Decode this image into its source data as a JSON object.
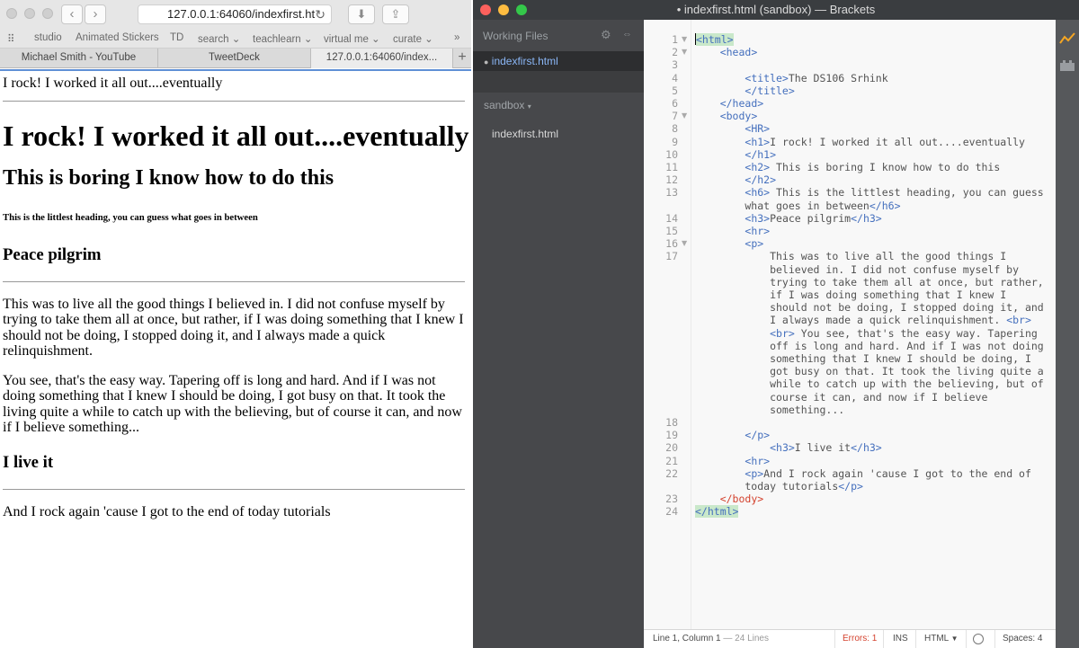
{
  "safari": {
    "url": "127.0.0.1:64060/indexfirst.ht",
    "bookmarks": [
      "studio",
      "Animated Stickers",
      "TD",
      "search",
      "teachlearn",
      "virtual me",
      "curate"
    ],
    "tabs": [
      "Michael Smith - YouTube",
      "TweetDeck",
      "127.0.0.1:64060/index..."
    ],
    "page": {
      "title_line": "I rock! I worked it all out....eventually",
      "h1": "I rock! I worked it all out....eventually",
      "h2": "This is boring I know how to do this",
      "h6": "This is the littlest heading, you can guess what goes in between",
      "h3_1": "Peace pilgrim",
      "p1": "This was to live all the good things I believed in. I did not confuse myself by trying to take them all at once, but rather, if I was doing something that I knew I should not be doing, I stopped doing it, and I always made a quick relinquishment.",
      "p2": "You see, that's the easy way. Tapering off is long and hard. And if I was not doing something that I knew I should be doing, I got busy on that. It took the living quite a while to catch up with the believing, but of course it can, and now if I believe something...",
      "h3_2": "I live it",
      "p3": "And I rock again 'cause I got to the end of today tutorials"
    }
  },
  "brackets": {
    "title": "• indexfirst.html (sandbox) — Brackets",
    "working_files_label": "Working Files",
    "working_file": "indexfirst.html",
    "project_label": "sandbox",
    "project_file": "indexfirst.html",
    "code_lines": [
      {
        "n": "1",
        "fold": "▼",
        "html": "<span id=\"cursor\"></span><span class=\"tg-g\">&lt;html&gt;</span>"
      },
      {
        "n": "2",
        "fold": "▼",
        "html": "    <span class=\"tg\">&lt;head&gt;</span>"
      },
      {
        "n": "3",
        "fold": "",
        "html": ""
      },
      {
        "n": "4",
        "fold": "",
        "html": "        <span class=\"tg\">&lt;title&gt;</span>The DS106 Srhink"
      },
      {
        "n": "5",
        "fold": "",
        "html": "        <span class=\"tg\">&lt;/title&gt;</span>"
      },
      {
        "n": "6",
        "fold": "",
        "html": "    <span class=\"tg\">&lt;/head&gt;</span>"
      },
      {
        "n": "7",
        "fold": "▼",
        "html": "    <span class=\"tg\">&lt;body&gt;</span>"
      },
      {
        "n": "8",
        "fold": "",
        "html": "        <span class=\"tg\">&lt;HR&gt;</span>"
      },
      {
        "n": "9",
        "fold": "",
        "html": "        <span class=\"tg\">&lt;h1&gt;</span>I rock! I worked it all out....eventually"
      },
      {
        "n": "10",
        "fold": "",
        "html": "        <span class=\"tg\">&lt;/h1&gt;</span>"
      },
      {
        "n": "11",
        "fold": "",
        "html": "        <span class=\"tg\">&lt;h2&gt;</span> This is boring I know how to do this"
      },
      {
        "n": "12",
        "fold": "",
        "html": "        <span class=\"tg\">&lt;/h2&gt;</span>"
      },
      {
        "n": "13",
        "fold": "",
        "html": "        <span class=\"tg\">&lt;h6&gt;</span> This is the littlest heading, you can guess"
      },
      {
        "n": "",
        "fold": "",
        "html": "        what goes in between<span class=\"tg\">&lt;/h6&gt;</span>"
      },
      {
        "n": "14",
        "fold": "",
        "html": "        <span class=\"tg\">&lt;h3&gt;</span>Peace pilgrim<span class=\"tg\">&lt;/h3&gt;</span>"
      },
      {
        "n": "15",
        "fold": "",
        "html": "        <span class=\"tg\">&lt;hr&gt;</span>"
      },
      {
        "n": "16",
        "fold": "▼",
        "html": "        <span class=\"tg\">&lt;p&gt;</span>"
      },
      {
        "n": "17",
        "fold": "",
        "html": "            This was to live all the good things I"
      },
      {
        "n": "",
        "fold": "",
        "html": "            believed in. I did not confuse myself by"
      },
      {
        "n": "",
        "fold": "",
        "html": "            trying to take them all at once, but rather,"
      },
      {
        "n": "",
        "fold": "",
        "html": "            if I was doing something that I knew I"
      },
      {
        "n": "",
        "fold": "",
        "html": "            should not be doing, I stopped doing it, and"
      },
      {
        "n": "",
        "fold": "",
        "html": "            I always made a quick relinquishment. <span class=\"tg\">&lt;br&gt;</span>"
      },
      {
        "n": "",
        "fold": "",
        "html": "            <span class=\"tg\">&lt;br&gt;</span> You see, that's the easy way. Tapering"
      },
      {
        "n": "",
        "fold": "",
        "html": "            off is long and hard. And if I was not doing"
      },
      {
        "n": "",
        "fold": "",
        "html": "            something that I knew I should be doing, I"
      },
      {
        "n": "",
        "fold": "",
        "html": "            got busy on that. It took the living quite a"
      },
      {
        "n": "",
        "fold": "",
        "html": "            while to catch up with the believing, but of"
      },
      {
        "n": "",
        "fold": "",
        "html": "            course it can, and now if I believe"
      },
      {
        "n": "",
        "fold": "",
        "html": "            something..."
      },
      {
        "n": "18",
        "fold": "",
        "html": ""
      },
      {
        "n": "19",
        "fold": "",
        "html": "        <span class=\"tg\">&lt;/p&gt;</span>"
      },
      {
        "n": "20",
        "fold": "",
        "html": "            <span class=\"tg\">&lt;h3&gt;</span>I live it<span class=\"tg\">&lt;/h3&gt;</span>"
      },
      {
        "n": "21",
        "fold": "",
        "html": "        <span class=\"tg\">&lt;hr&gt;</span>"
      },
      {
        "n": "22",
        "fold": "",
        "html": "        <span class=\"tg\">&lt;p&gt;</span>And I rock again 'cause I got to the end of"
      },
      {
        "n": "",
        "fold": "",
        "html": "        today tutorials<span class=\"tg\">&lt;/p&gt;</span>"
      },
      {
        "n": "23",
        "fold": "",
        "html": "    <span class=\"tg-r\">&lt;/body&gt;</span>"
      },
      {
        "n": "24",
        "fold": "",
        "html": "<span class=\"tg-g\">&lt;/html&gt;</span>"
      }
    ],
    "status": {
      "position": "Line 1, Column 1",
      "lines": "— 24 Lines",
      "errors": "Errors: 1",
      "mode": "INS",
      "language": "HTML",
      "spaces": "Spaces: 4"
    }
  }
}
